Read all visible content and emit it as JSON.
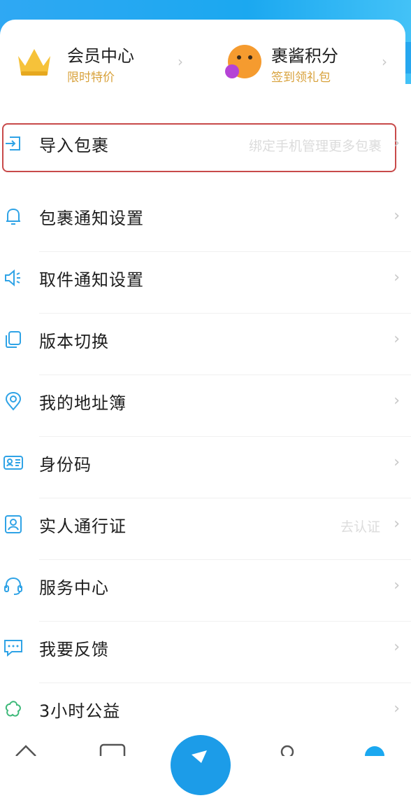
{
  "promo": {
    "left": {
      "title": "会员中心",
      "subtitle": "限时特价",
      "icon": "crown-icon"
    },
    "right": {
      "title": "裹酱积分",
      "subtitle": "签到领礼包",
      "icon": "mascot-icon"
    }
  },
  "list": {
    "items": [
      {
        "key": "import",
        "label": "导入包裹",
        "hint": "绑定手机管理更多包裹",
        "icon": "import-icon"
      },
      {
        "key": "package_notify",
        "label": "包裹通知设置",
        "hint": "",
        "icon": "bell-icon"
      },
      {
        "key": "pickup_notify",
        "label": "取件通知设置",
        "hint": "",
        "icon": "speaker-icon"
      },
      {
        "key": "version",
        "label": "版本切换",
        "hint": "",
        "icon": "switch-icon"
      },
      {
        "key": "address",
        "label": "我的地址簿",
        "hint": "",
        "icon": "location-icon"
      },
      {
        "key": "idcode",
        "label": "身份码",
        "hint": "",
        "icon": "id-card-icon"
      },
      {
        "key": "realname",
        "label": "实人通行证",
        "hint": "去认证",
        "icon": "user-badge-icon"
      },
      {
        "key": "service",
        "label": "服务中心",
        "hint": "",
        "icon": "headset-icon"
      },
      {
        "key": "feedback",
        "label": "我要反馈",
        "hint": "",
        "icon": "chat-icon"
      },
      {
        "key": "charity",
        "label": "3小时公益",
        "hint": "",
        "icon": "charity-icon"
      }
    ]
  },
  "colors": {
    "accent": "#1ba8f0",
    "gold": "#d8a23c",
    "icon_blue": "#2fa3e6",
    "highlight_border": "#c84a4a"
  }
}
